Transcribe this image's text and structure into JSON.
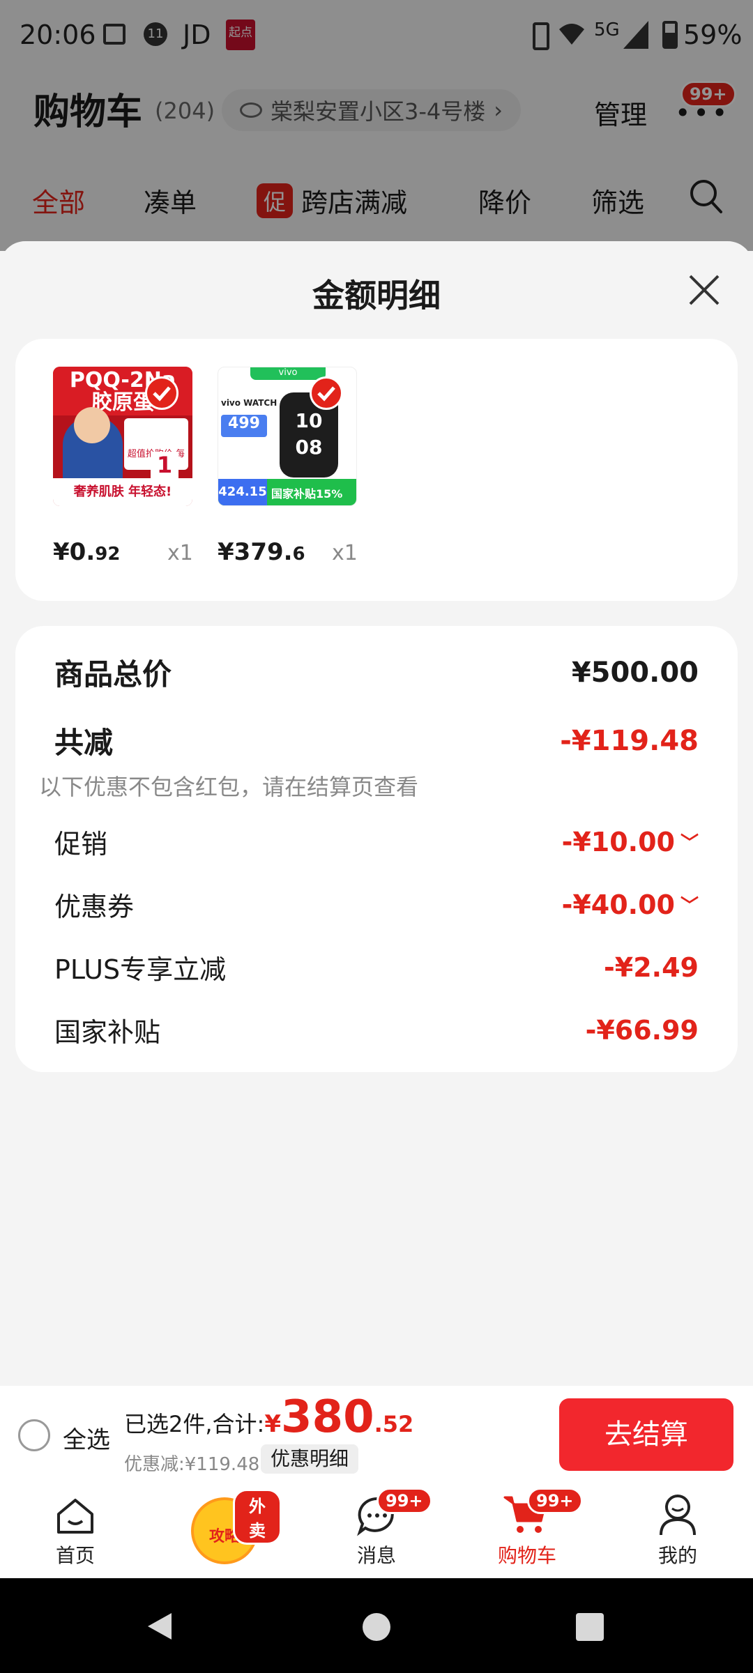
{
  "status_bar": {
    "time": "20:06",
    "network": "5G",
    "battery": "59%",
    "notif_jd": "JD",
    "notif_num": "11",
    "qidian_label": "起点"
  },
  "header": {
    "title": "购物车",
    "count": "(204)",
    "address": "棠梨安置小区3-4号楼",
    "address_arrow": "›",
    "manage_label": "管理",
    "more_badge": "99+"
  },
  "filter_tabs": [
    {
      "label": "全部"
    },
    {
      "label": "凑单"
    },
    {
      "label": "跨店满减",
      "tag": "促"
    },
    {
      "label": "降价"
    },
    {
      "label": "筛选"
    }
  ],
  "sheet": {
    "title": "金额明细",
    "close_icon": "close-icon"
  },
  "products": [
    {
      "price_main": "¥0.",
      "price_dec": "92",
      "qty": "x1",
      "img_text_top": "PQQ-2Na",
      "img_text_mid": "胶原蛋",
      "img_text_bottom": "奢养肌肤 年轻态!",
      "img_badge": "1",
      "img_note": "超值抢购价 每条"
    },
    {
      "price_main": "¥379.",
      "price_dec": "6",
      "qty": "x1",
      "img_brand": "vivo",
      "img_model": "vivo WATCH GT",
      "img_price": "499",
      "img_subsidy_price": "424.15",
      "img_subsidy_label": "国家补贴15%",
      "watch_face": "10 08"
    }
  ],
  "summary": {
    "total_label": "商品总价",
    "total_value": "¥500.00",
    "reduce_label": "共减",
    "reduce_value": "-¥119.48",
    "reduce_note": "以下优惠不包含红包，请在结算页查看",
    "items": [
      {
        "label": "促销",
        "value": "-¥10.00",
        "chevron": "﹀"
      },
      {
        "label": "优惠券",
        "value": "-¥40.00",
        "chevron": "﹀"
      },
      {
        "label": "PLUS专享立减",
        "value": "-¥2.49",
        "chevron": ""
      },
      {
        "label": "国家补贴",
        "value": "-¥66.99",
        "chevron": ""
      }
    ]
  },
  "checkout": {
    "select_all": "全选",
    "selected_text": "已选2件,合计:",
    "currency": "¥",
    "total_int": "380",
    "total_dec": ".52",
    "discount_text": "优惠减:¥119.48",
    "detail_button": "优惠明细",
    "checkout_button": "去结算"
  },
  "tabbar": [
    {
      "label": "首页",
      "icon": "home-icon",
      "badge": ""
    },
    {
      "label": "攻略",
      "icon": "strategy-bag-icon",
      "badge": "外卖"
    },
    {
      "label": "消息",
      "icon": "message-icon",
      "badge": "99+"
    },
    {
      "label": "购物车",
      "icon": "cart-icon",
      "badge": "99+"
    },
    {
      "label": "我的",
      "icon": "profile-icon",
      "badge": ""
    }
  ],
  "colors": {
    "accent": "#e2231a",
    "sheet_bg": "#f4f4f4",
    "card_bg": "#ffffff"
  }
}
